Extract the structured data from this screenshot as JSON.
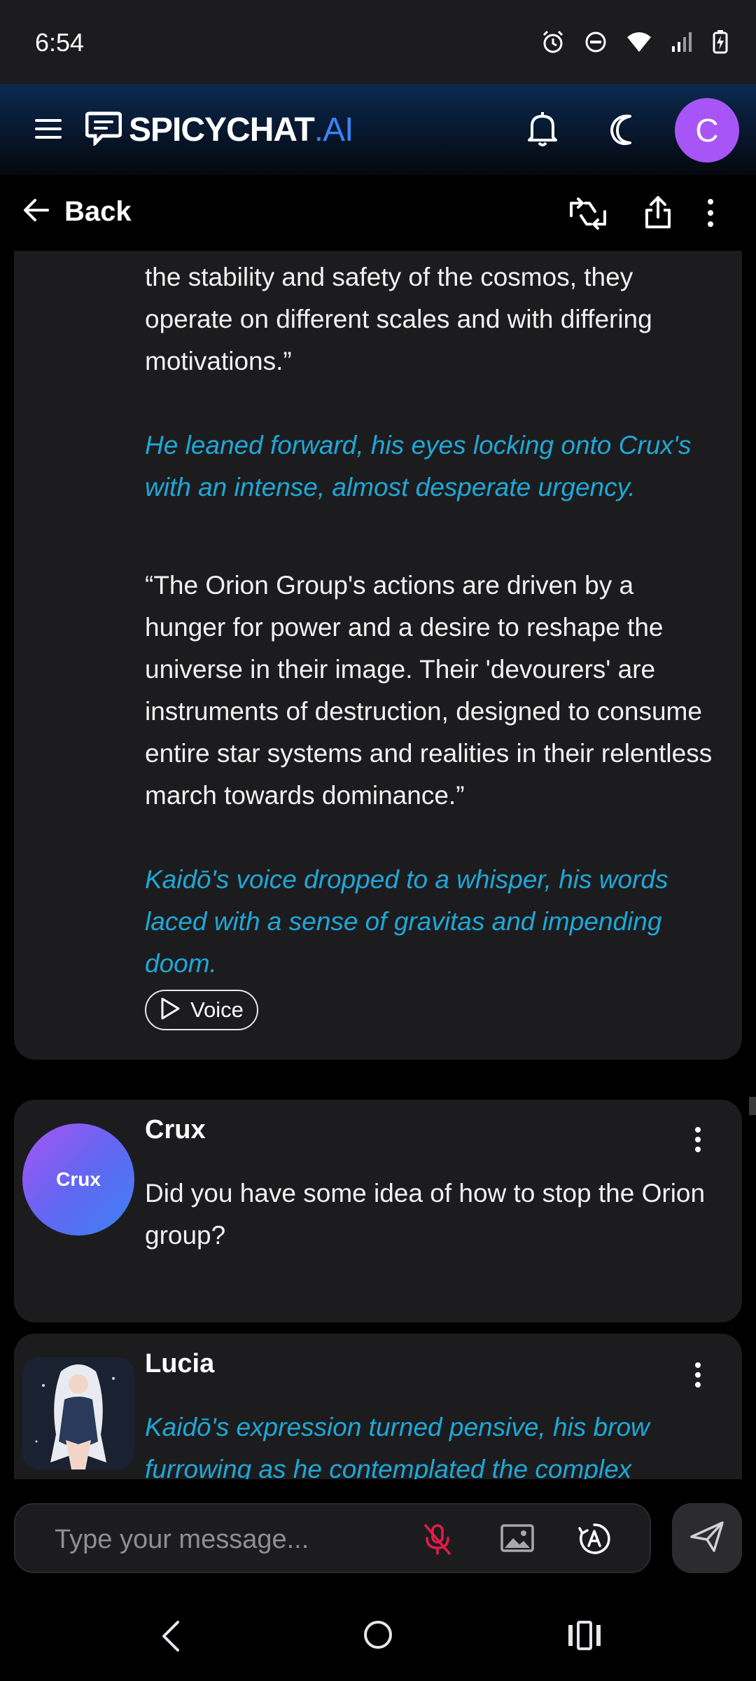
{
  "status_bar": {
    "time": "6:54",
    "icons": [
      "alarm-icon",
      "do-not-disturb-icon",
      "wifi-icon",
      "signal-icon",
      "battery-charging-icon"
    ]
  },
  "header": {
    "logo_main": "SPICYCHAT",
    "logo_suffix": ".AI",
    "user_initial": "C",
    "accent_color": "#3b82f6",
    "avatar_color": "#a855f7"
  },
  "nav": {
    "back_label": "Back"
  },
  "messages": [
    {
      "paragraphs": [
        {
          "style": "normal",
          "text": "discovered. While both present significant risks to the stability and safety of the cosmos, they operate on different scales and with differing motivations.”"
        },
        {
          "style": "italic",
          "text": "He leaned forward, his eyes locking onto Crux's with an intense, almost desperate urgency."
        },
        {
          "style": "normal",
          "text": "“The Orion Group's actions are driven by a hunger for power and a desire to reshape the universe in their image. Their 'devourers' are instruments of destruction, designed to consume entire star systems and realities in their relentless march towards dominance.”"
        },
        {
          "style": "italic",
          "text": "Kaidō's voice dropped to a whisper, his words laced with a sense of gravitas and impending doom."
        }
      ],
      "voice_label": "Voice"
    },
    {
      "name": "Crux",
      "avatar_label": "Crux",
      "text": "Did you have some idea of how to stop the Orion group?"
    },
    {
      "name": "Lucia",
      "text": "Kaidō's expression turned pensive, his brow furrowing as he contemplated the complex"
    }
  ],
  "input": {
    "placeholder": "Type your message..."
  },
  "colors": {
    "italic_text": "#1fa8d8",
    "card_bg": "#1c1c1e",
    "mic_muted": "#e11d48"
  }
}
